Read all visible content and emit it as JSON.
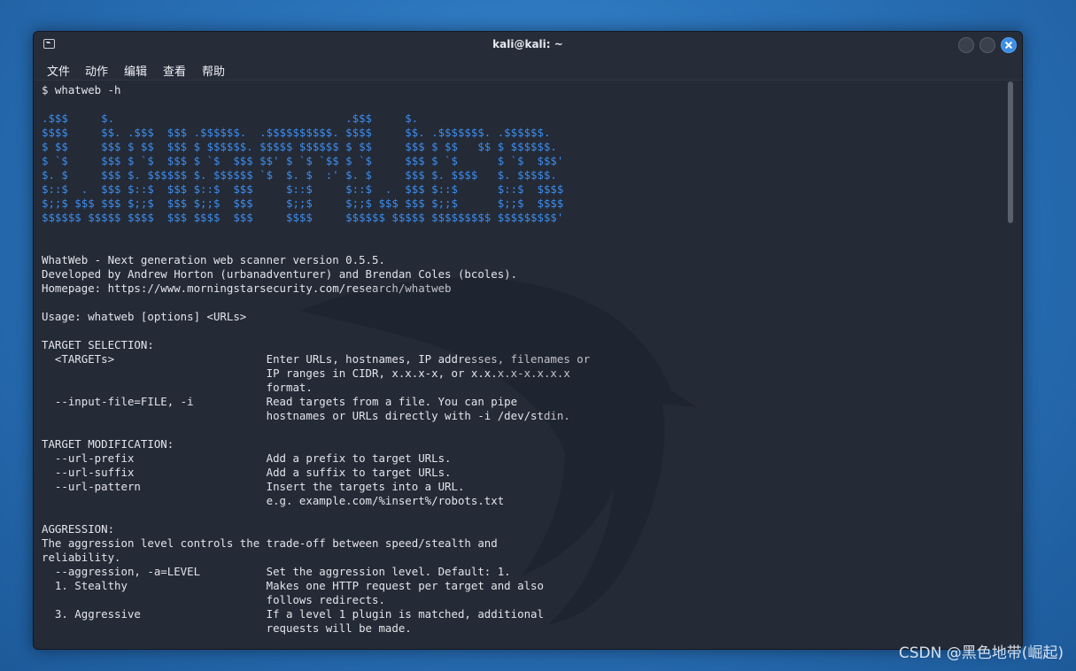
{
  "window": {
    "title": "kali@kali: ~"
  },
  "menu": [
    "文件",
    "动作",
    "编辑",
    "查看",
    "帮助"
  ],
  "terminal": {
    "prompt_line": "$ whatweb -h",
    "ascii_banner": [
      ".$$$     $.                                   .$$$     $.",
      "$$$$     $$. .$$$  $$$ .$$$$$$.  .$$$$$$$$$$. $$$$     $$. .$$$$$$$. .$$$$$$.",
      "$ $$     $$$ $ $$  $$$ $ $$$$$$. $$$$$ $$$$$$ $ $$     $$$ $ $$   $$ $ $$$$$$.",
      "$ `$     $$$ $ `$  $$$ $ `$  $$$ $$' $ `$ `$$ $ `$     $$$ $ `$      $ `$  $$$'",
      "$. $     $$$ $. $$$$$$ $. $$$$$$ `$  $. $  :' $. $     $$$ $. $$$$   $. $$$$$.",
      "$::$  .  $$$ $::$  $$$ $::$  $$$     $::$     $::$  .  $$$ $::$      $::$  $$$$",
      "$;;$ $$$ $$$ $;;$  $$$ $;;$  $$$     $;;$     $;;$ $$$ $$$ $;;$      $;;$  $$$$",
      "$$$$$$ $$$$$ $$$$  $$$ $$$$  $$$     $$$$     $$$$$$ $$$$$ $$$$$$$$$ $$$$$$$$$'"
    ],
    "body_lines": [
      "WhatWeb - Next generation web scanner version 0.5.5.",
      "Developed by Andrew Horton (urbanadventurer) and Brendan Coles (bcoles).",
      "Homepage: https://www.morningstarsecurity.com/research/whatweb",
      "",
      "Usage: whatweb [options] <URLs>",
      "",
      "TARGET SELECTION:",
      "  <TARGETs>                       Enter URLs, hostnames, IP addresses, filenames or",
      "                                  IP ranges in CIDR, x.x.x-x, or x.x.x.x-x.x.x.x",
      "                                  format.",
      "  --input-file=FILE, -i           Read targets from a file. You can pipe",
      "                                  hostnames or URLs directly with -i /dev/stdin.",
      "",
      "TARGET MODIFICATION:",
      "  --url-prefix                    Add a prefix to target URLs.",
      "  --url-suffix                    Add a suffix to target URLs.",
      "  --url-pattern                   Insert the targets into a URL.",
      "                                  e.g. example.com/%insert%/robots.txt",
      "",
      "AGGRESSION:",
      "The aggression level controls the trade-off between speed/stealth and",
      "reliability.",
      "  --aggression, -a=LEVEL          Set the aggression level. Default: 1.",
      "  1. Stealthy                     Makes one HTTP request per target and also",
      "                                  follows redirects.",
      "  3. Aggressive                   If a level 1 plugin is matched, additional",
      "                                  requests will be made."
    ]
  },
  "watermark": "CSDN @黑色地带(崛起)",
  "colors": {
    "banner": "#3d8ef0",
    "terminal_bg": "#242a36",
    "close_button": "#3c8ee4"
  }
}
